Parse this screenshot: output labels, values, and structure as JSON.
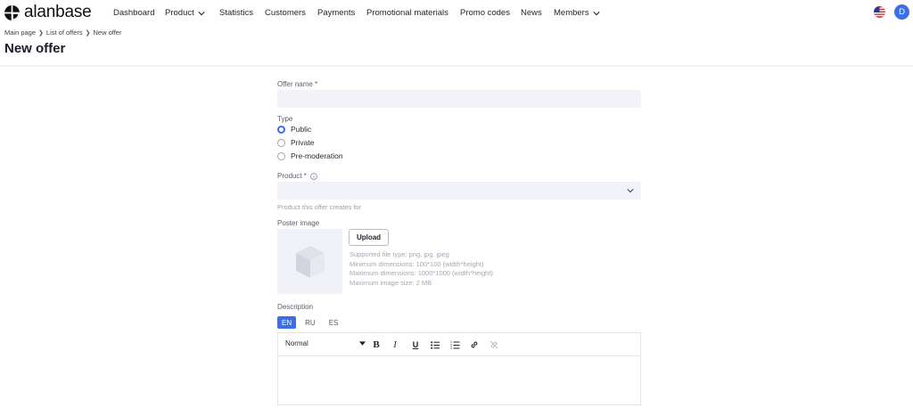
{
  "app": {
    "logo_text": "alanbase",
    "user_initial": "D"
  },
  "nav": {
    "items": [
      {
        "label": "Dashboard",
        "has_dropdown": false
      },
      {
        "label": "Product",
        "has_dropdown": true
      },
      {
        "label": "Statistics",
        "has_dropdown": false
      },
      {
        "label": "Customers",
        "has_dropdown": false
      },
      {
        "label": "Payments",
        "has_dropdown": false
      },
      {
        "label": "Promotional materials",
        "has_dropdown": false
      },
      {
        "label": "Promo codes",
        "has_dropdown": false
      },
      {
        "label": "News",
        "has_dropdown": false
      },
      {
        "label": "Members",
        "has_dropdown": true
      }
    ]
  },
  "breadcrumb": [
    "Main page",
    "List of offers",
    "New offer"
  ],
  "page": {
    "title": "New offer"
  },
  "form": {
    "offer_name": {
      "label": "Offer name *",
      "value": ""
    },
    "type": {
      "label": "Type",
      "options": [
        "Public",
        "Private",
        "Pre-moderation"
      ],
      "selected": "Public"
    },
    "product": {
      "label": "Product *",
      "value": "",
      "hint": "Product this offer creates for"
    },
    "poster": {
      "label": "Poster image",
      "upload_label": "Upload",
      "hints": [
        "Supported file type: png, jpg, jpeg",
        "Minimum dimensions: 100*100 (width*height)",
        "Maximum dimensions: 1000*1000 (width*height)",
        "Maximum image size: 2 MB"
      ]
    },
    "description": {
      "label": "Description",
      "languages": [
        "EN",
        "RU",
        "ES"
      ],
      "active_language": "EN",
      "format_value": "Normal"
    }
  },
  "colors": {
    "accent": "#3c6ee8",
    "input_bg": "#f2f3f8"
  }
}
